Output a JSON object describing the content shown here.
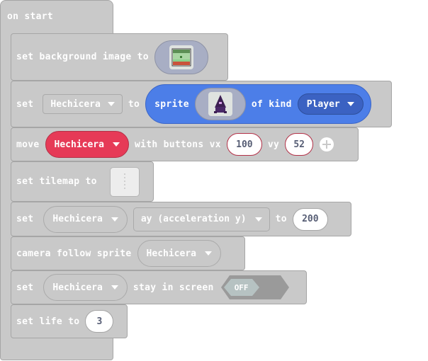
{
  "on_start": {
    "label": "on start"
  },
  "bg_block": {
    "label": "set background image to",
    "thumb_icon": "background-image-thumbnail"
  },
  "sprite_block": {
    "set_label": "set",
    "var_name": "Hechicera",
    "to_label": "to",
    "sprite_label": "sprite",
    "of_kind_label": "of kind",
    "kind_value": "Player",
    "thumb_icon": "sprite-image-thumbnail"
  },
  "move_block": {
    "move_label": "move",
    "var_name": "Hechicera",
    "with_buttons_label": "with buttons vx",
    "vx": "100",
    "vy_label": "vy",
    "vy": "52"
  },
  "tilemap_block": {
    "label": "set tilemap to",
    "thumb_icon": "tilemap-thumbnail"
  },
  "accel_block": {
    "set_label": "set",
    "var_name": "Hechicera",
    "property": "ay (acceleration y)",
    "to_label": "to",
    "value": "200"
  },
  "camera_block": {
    "label": "camera follow sprite",
    "var_name": "Hechicera"
  },
  "stay_block": {
    "set_label": "set",
    "var_name": "Hechicera",
    "stay_label": "stay in screen",
    "toggle_label": "OFF"
  },
  "life_block": {
    "label": "set life to",
    "value": "3"
  },
  "colors": {
    "block_grey": "#c9c9c9",
    "sprite_blue": "#4c7ee8",
    "kind_blue": "#3b62c2",
    "move_red": "#e63a57",
    "toggle_grey": "#9a9a9a",
    "toggle_off_bg": "#b6c2c2"
  }
}
